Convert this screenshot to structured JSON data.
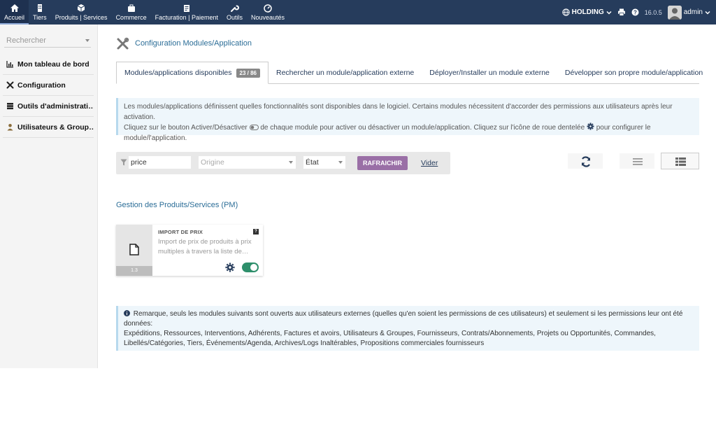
{
  "topnav": [
    {
      "label": "Accueil",
      "icon": "home-icon",
      "active": true
    },
    {
      "label": "Tiers",
      "icon": "building-icon"
    },
    {
      "label": "Produits | Services",
      "icon": "cube-icon"
    },
    {
      "label": "Commerce",
      "icon": "briefcase-icon"
    },
    {
      "label": "Facturation | Paiement",
      "icon": "money-icon"
    },
    {
      "label": "Outils",
      "icon": "wrench-icon"
    },
    {
      "label": "Nouveautés",
      "icon": "gauge-icon"
    }
  ],
  "topright": {
    "company": "HOLDING",
    "version": "16.0.5",
    "user": "admin"
  },
  "sidebar": {
    "search_placeholder": "Rechercher",
    "items": [
      {
        "label": "Mon tableau de bord",
        "icon": "chart-icon"
      },
      {
        "label": "Configuration",
        "icon": "tools-icon"
      },
      {
        "label": "Outils d'administrati…",
        "icon": "server-icon"
      },
      {
        "label": "Utilisateurs & Group…",
        "icon": "user-icon"
      }
    ]
  },
  "page": {
    "title": "Configuration Modules/Application"
  },
  "tabs": [
    {
      "label": "Modules/applications disponibles",
      "badge": "23 / 86",
      "active": true
    },
    {
      "label": "Rechercher un module/application externe"
    },
    {
      "label": "Déployer/Installer un module externe"
    },
    {
      "label": "Développer son propre module/application"
    }
  ],
  "info": {
    "line1": "Les modules/applications définissent quelles fonctionnalités sont disponibles dans le logiciel. Certains modules nécessitent d'accorder des permissions aux utilisateurs après leur activation.",
    "line2a": "Cliquez sur le bouton Activer/Désactiver",
    "line2b": "de chaque module pour activer ou désactiver un module/application. Cliquez sur l'icône de roue dentelée",
    "line2c": "pour configurer le module/l'application."
  },
  "filter": {
    "search_value": "price",
    "origin_placeholder": "Origine",
    "state_value": "État",
    "refresh_label": "RAFRAICHIR",
    "clear_label": "Vider"
  },
  "section": {
    "title": "Gestion des Produits/Services (PM)"
  },
  "module_card": {
    "title": "IMPORT DE PRIX",
    "description": "Import de prix de produits à prix multiples à travers la liste de…",
    "version": "1.3",
    "help": "?",
    "enabled": true
  },
  "note": {
    "line1": "Remarque, seuls les modules suivants sont ouverts aux utilisateurs externes (quelles qu'en soient les permissions de ces utilisateurs) et seulement si les permissions leur ont été données:",
    "line2": "Expéditions, Ressources, Interventions, Adhérents, Factures et avoirs, Utilisateurs & Groupes, Fournisseurs, Contrats/Abonnements, Projets ou Opportunités, Commandes,",
    "line3": "Libellés/Catégories, Tiers, Événements/Agenda, Archives/Logs Inaltérables, Propositions commerciales fournisseurs"
  },
  "colors": {
    "topbar": "#263c5c",
    "accent_title": "#2b6d97",
    "refresh_button": "#9a6fa6",
    "toggle_on": "#2e8f6b"
  }
}
